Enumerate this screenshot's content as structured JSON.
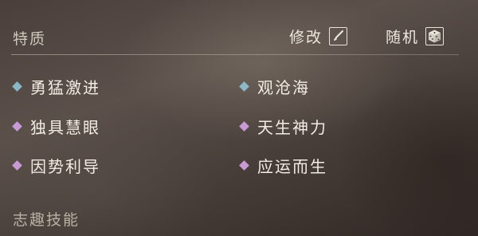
{
  "header": {
    "title": "特质",
    "modify_label": "修改",
    "random_label": "随机"
  },
  "traits": [
    {
      "name": "勇猛激进",
      "rarity": "blue"
    },
    {
      "name": "观沧海",
      "rarity": "blue"
    },
    {
      "name": "独具慧眼",
      "rarity": "purple"
    },
    {
      "name": "天生神力",
      "rarity": "purple"
    },
    {
      "name": "因势利导",
      "rarity": "purple"
    },
    {
      "name": "应运而生",
      "rarity": "purple"
    }
  ],
  "colors": {
    "blue_gem": "#8bb7c6",
    "purple_gem": "#c79ad3"
  },
  "icons": {
    "modify": "brush-icon",
    "random": "dice-icon"
  },
  "section2": {
    "title": "志趣技能"
  }
}
